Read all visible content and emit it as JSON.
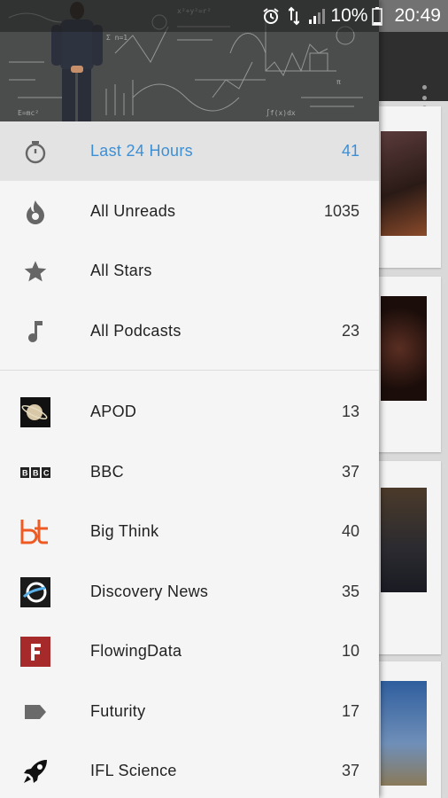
{
  "status_bar": {
    "battery_percent": "10%",
    "time": "20:49",
    "icons": [
      "alarm-icon",
      "data-arrows-icon",
      "signal-icon",
      "battery-icon"
    ]
  },
  "colors": {
    "accent": "#3d8fd6",
    "drawer_bg": "#f5f5f5",
    "active_row_bg": "#e3e3e3"
  },
  "drawer": {
    "smart_items": [
      {
        "label": "Last 24 Hours",
        "count": "41",
        "icon": "stopwatch-icon",
        "active": true
      },
      {
        "label": "All Unreads",
        "count": "1035",
        "icon": "flame-icon"
      },
      {
        "label": "All Stars",
        "count": "",
        "icon": "star-icon"
      },
      {
        "label": "All Podcasts",
        "count": "23",
        "icon": "music-note-icon"
      }
    ],
    "feeds": [
      {
        "label": "APOD",
        "count": "13",
        "icon": "apod-logo-icon"
      },
      {
        "label": "BBC",
        "count": "37",
        "icon": "bbc-logo-icon"
      },
      {
        "label": "Big Think",
        "count": "40",
        "icon": "bigthink-logo-icon"
      },
      {
        "label": "Discovery News",
        "count": "35",
        "icon": "discovery-logo-icon"
      },
      {
        "label": "FlowingData",
        "count": "10",
        "icon": "flowingdata-logo-icon"
      },
      {
        "label": "Futurity",
        "count": "17",
        "icon": "tag-icon"
      },
      {
        "label": "IFL Science",
        "count": "37",
        "icon": "rocket-icon"
      }
    ]
  }
}
